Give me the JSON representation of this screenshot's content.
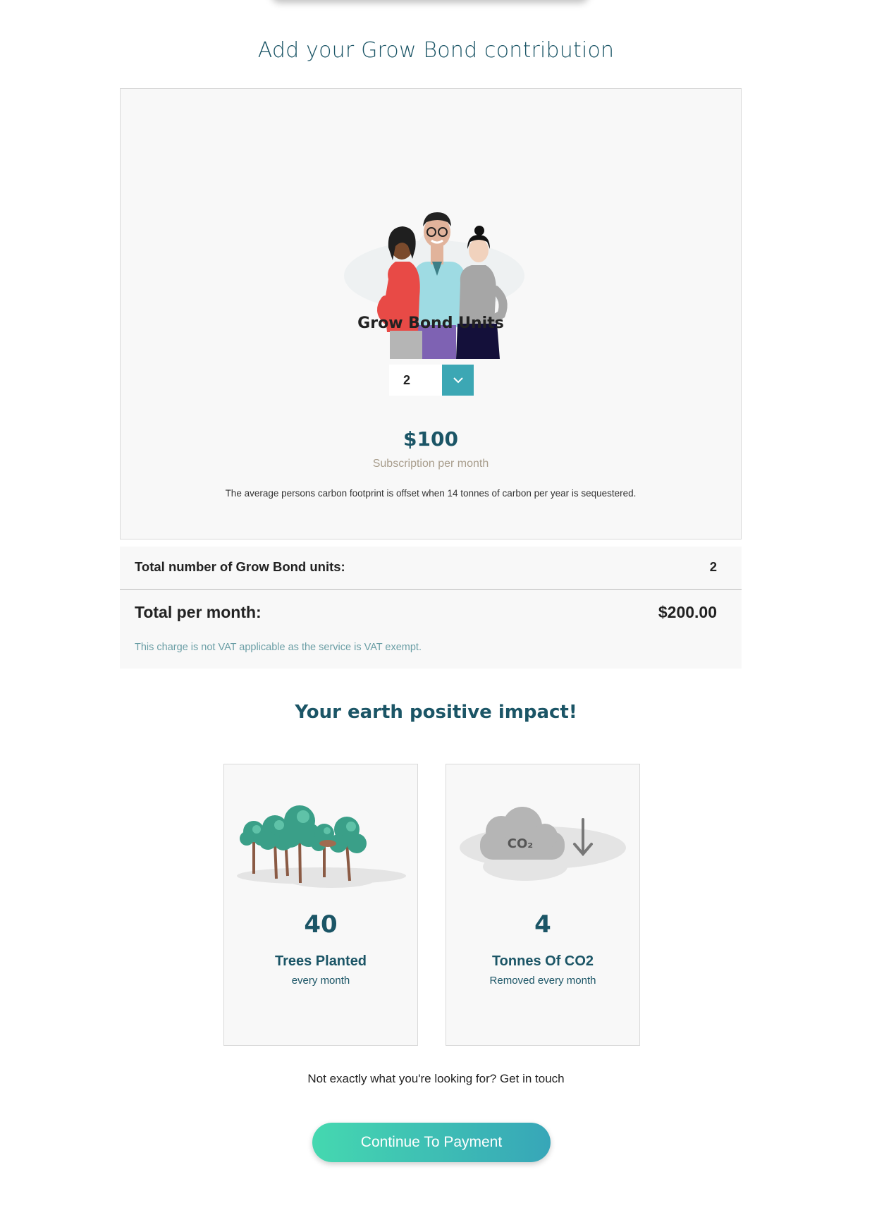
{
  "heading": "Add your Grow Bond contribution",
  "product": {
    "units_title": "Grow Bond Units",
    "units_selected": "2",
    "price": "$100",
    "price_caption": "Subscription per month",
    "footprint_note": "The average persons carbon footprint is offset when 14 tonnes of carbon per year is sequestered."
  },
  "summary": {
    "units_label": "Total number of Grow Bond units:",
    "units_value": "2",
    "total_label": "Total per month:",
    "total_value": "$200.00",
    "vat_note": "This charge is not VAT applicable as the service is VAT exempt."
  },
  "impact": {
    "heading": "Your earth positive impact!",
    "cards": [
      {
        "number": "40",
        "label": "Trees Planted",
        "sub": "every month",
        "icon": "trees-illustration"
      },
      {
        "number": "4",
        "label": "Tonnes Of CO2",
        "sub": "Removed every month",
        "icon": "co2-cloud-illustration",
        "icon_text": "CO₂"
      }
    ]
  },
  "contact_line": "Not exactly what you're looking for? Get in touch",
  "continue_label": "Continue To Payment",
  "colors": {
    "brand_dark": "#1b5566",
    "accent": "#3ca7b4",
    "gradient_start": "#45d8b0",
    "muted": "#a89d8c"
  }
}
